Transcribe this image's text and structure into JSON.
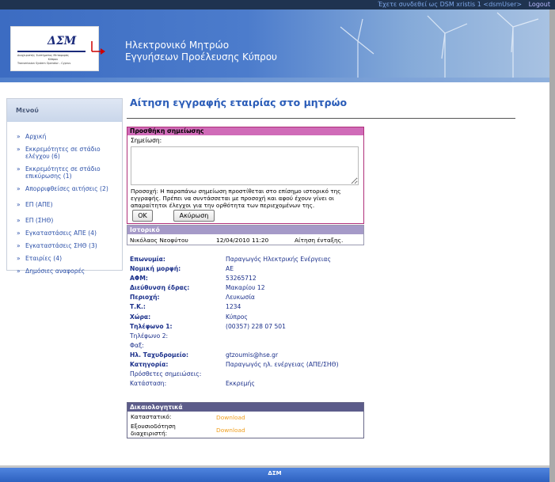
{
  "topbar": {
    "login_text": "Έχετε συνδεθεί ως DSM xristis 1 <dsmUser>",
    "logout": "Logout"
  },
  "banner": {
    "title_line1": "Ηλεκτρονικό Μητρώο",
    "title_line2": "Εγγυήσεων Προέλευσης Κύπρου",
    "logo": {
      "text": "ΔΣΜ",
      "sub_line1": "Διαχειριστής Συστήματος Μεταφοράς",
      "sub_line2": "Κύπρου",
      "sub_line3": "Transmission System Operator - Cyprus"
    }
  },
  "sidebar": {
    "header": "Μενού",
    "items": [
      {
        "label": "Αρχική"
      },
      {
        "label": "Εκκρεμότητες σε στάδιο ελέγχου (6)"
      },
      {
        "label": "Εκκρεμότητες σε στάδιο επικύρωσης (1)"
      },
      {
        "label": "Απορριφθείσες αιτήσεις (2)"
      },
      {
        "label": "ΕΠ (ΑΠΕ)"
      },
      {
        "label": "ΕΠ (ΣΗΘ)"
      },
      {
        "label": "Εγκαταστάσεις ΑΠΕ (4)"
      },
      {
        "label": "Εγκαταστάσεις ΣΗΘ (3)"
      },
      {
        "label": "Εταιρίες (4)"
      },
      {
        "label": "Δημόσιες αναφορές"
      }
    ]
  },
  "main": {
    "title": "Αίτηση εγγραφής εταιρίας στο μητρώο",
    "note": {
      "header": "Προσθήκη σημείωσης",
      "label": "Σημείωση:",
      "value": "",
      "info": "Προσοχή: Η παραπάνω σημείωση προστίθεται στο επίσημο ιστορικό της εγγραφής. Πρέπει να συντάσσεται με προσοχή και αφού έχουν γίνει οι απαραίτητοι έλεγχοι για την ορθότητα των περιεχομένων της.",
      "ok": "OK",
      "cancel": "Ακύρωση"
    },
    "history": {
      "header": "Ιστορικό",
      "name": "Νικόλαος Νεοφύτου",
      "datetime": "12/04/2010 11:20",
      "action": "Αίτηση ένταξης."
    },
    "details": [
      {
        "label": "Επωνυμία:",
        "value": "Παραγωγός Ηλεκτρικής Ενέργειας",
        "bold": true
      },
      {
        "label": "Νομική μορφή:",
        "value": "ΑΕ",
        "bold": true
      },
      {
        "label": "ΑΦΜ:",
        "value": "53265712",
        "bold": true
      },
      {
        "label": "Διεύθυνση έδρας:",
        "value": "Μακαρίου 12",
        "bold": true
      },
      {
        "label": "Περιοχή:",
        "value": "Λευκωσία",
        "bold": true
      },
      {
        "label": "Τ.Κ.:",
        "value": "1234",
        "bold": true
      },
      {
        "label": "Χώρα:",
        "value": "Κύπρος",
        "bold": true
      },
      {
        "label": "Τηλέφωνο 1:",
        "value": "(00357) 228 07 501",
        "bold": true
      },
      {
        "label": "Τηλέφωνο 2:",
        "value": "",
        "bold": false
      },
      {
        "label": "Φαξ:",
        "value": "",
        "bold": false
      },
      {
        "label": "Ηλ. Ταχυδρομείο:",
        "value": "gtzoumis@hse.gr",
        "bold": true
      },
      {
        "label": "Κατηγορία:",
        "value": "Παραγωγός ηλ. ενέργειας (ΑΠΕ/ΣΗΘ)",
        "bold": true
      },
      {
        "label": "Πρόσθετες σημειώσεις:",
        "value": "",
        "bold": false
      },
      {
        "label": "Κατάσταση:",
        "value": "Εκκρεμής",
        "bold": false
      }
    ],
    "docs": {
      "header": "Δικαιολογητικά",
      "row1_label": "Καταστατικό:",
      "row1_link": "Download",
      "row2_label_line1": "Εξουσιοδότηση",
      "row2_label_line2": "διαχειριστή:",
      "row2_link": "Download"
    }
  },
  "footer": {
    "text": "ΔΣΜ"
  }
}
